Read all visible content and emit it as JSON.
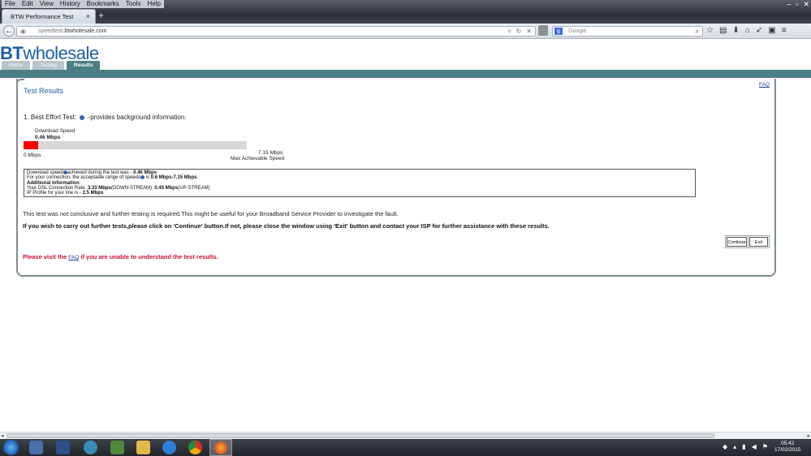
{
  "browser": {
    "menu": [
      "File",
      "Edit",
      "View",
      "History",
      "Bookmarks",
      "Tools",
      "Help"
    ],
    "tab_title": "BTW Performance Test",
    "url_prefix": "speedtest.",
    "url_domain": "btwholesale.com",
    "search_placeholder": "Google",
    "search_engine_letter": "g"
  },
  "site": {
    "logo_bt": "BT",
    "logo_wholesale": "wholesale",
    "tabs": [
      "Home",
      "Testing",
      "Results"
    ],
    "active_tab": "Results",
    "faq": "FAQ",
    "title": "Test Results",
    "section_heading_prefix": "1. Best Effort Test:",
    "section_heading_suffix": "-provides background information."
  },
  "speed": {
    "label": "Download  Speed",
    "value": "0.46 Mbps",
    "fill_fraction": 0.064,
    "scale_min": "0 Mbps",
    "scale_max": "7.15 Mbps",
    "scale_max_label": "Max Achievable Speed"
  },
  "details": {
    "line1_prefix": "Download speed",
    "line1_suffix": "achieved during the test was - ",
    "line1_value": "0.46 Mbps",
    "line2_prefix": "For your connection, the acceptable range of speeds",
    "line2_mid": " is ",
    "line2_value": "0.6 Mbps-7.15 Mbps",
    "line2_end": ".",
    "heading": "Additional Information:",
    "line3_prefix": "Your DSL Connection Rate :",
    "line3_down": "3.33 Mbps",
    "line3_down_label": "(DOWN-STREAM), ",
    "line3_up": "0.45 Mbps",
    "line3_up_label": "(UP-STREAM)",
    "line4_prefix": "IP Profile for your line is - ",
    "line4_value": "2.5 Mbps"
  },
  "messages": {
    "inconclusive": "This test was not conclusive and further testing is required.This might be useful for your Broadband Service Provider to investigate the fault.",
    "instruction": "If you wish to carry out further tests,please click on 'Continue' button.If not, please close the window using 'Exit' button and contact your ISP for further assistance with these results.",
    "visit_prefix": "Please visit the ",
    "visit_link": "FAQ",
    "visit_suffix": " if you are unable to understand the test results."
  },
  "buttons": {
    "continue": "Continue",
    "exit": "Exit"
  },
  "taskbar": {
    "time": "05:42",
    "date": "17/02/2015"
  },
  "colors": {
    "brand_blue": "#1c5fa8",
    "teal_band": "#4a7f86",
    "meter_fill": "#ff0000",
    "warning_red": "#c8102e"
  }
}
